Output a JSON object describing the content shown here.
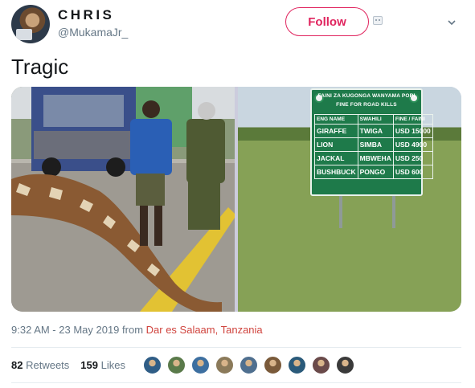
{
  "user": {
    "name": "CHRIS",
    "handle": "@MukamaJr_",
    "follow_label": "Follow"
  },
  "tweet": {
    "text": "Tragic",
    "time_date": "9:32 AM - 23 May 2019 from ",
    "location": "Dar es Salaam, Tanzania"
  },
  "sign": {
    "title_line1": "FAINI ZA KUGONGA WANYAMA PORI",
    "title_line2": "FINE FOR ROAD KILLS",
    "headers": [
      "ENG NAME",
      "SWAHILI",
      "FINE / FAINI"
    ],
    "rows": [
      [
        "GIRAFFE",
        "TWIGA",
        "USD 15000"
      ],
      [
        "LION",
        "SIMBA",
        "USD 4900"
      ],
      [
        "JACKAL",
        "MBWEHA",
        "USD 250"
      ],
      [
        "BUSHBUCK",
        "PONGO",
        "USD 600"
      ]
    ]
  },
  "engagement": {
    "retweets_count": "82",
    "retweets_label": "Retweets",
    "likes_count": "159",
    "likes_label": "Likes"
  },
  "colors": {
    "accent": "#e0245e",
    "location": "#d0443e",
    "muted": "#657786",
    "sign_green": "#1e7a4a"
  },
  "likers": [
    "#2f5d86",
    "#5a7a4a",
    "#3d6fa0",
    "#8b7a5a",
    "#4f6f8f",
    "#7a5a3a",
    "#2a5a7a",
    "#6a4a4a",
    "#3a3a3a"
  ]
}
